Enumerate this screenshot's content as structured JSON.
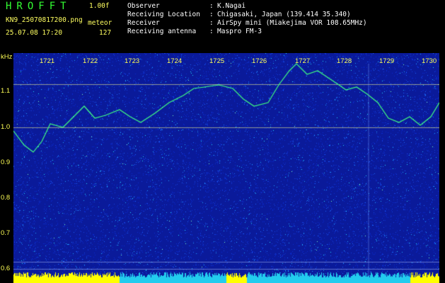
{
  "header": {
    "title": "HROFFT",
    "version": "1.00f",
    "filename": "KN9_25070817200.png",
    "mode": "meteor",
    "datetime": "25.07.08 17:20",
    "count": "127",
    "fields": [
      {
        "label": "Observer",
        "value": "K.Nagai"
      },
      {
        "label": "Receiving Location",
        "value": "Chigasaki, Japan (139.414 35.340)"
      },
      {
        "label": "Receiver",
        "value": "AirSpy mini (Miakejima VOR 108.65MHz)"
      },
      {
        "label": "Receiving antenna",
        "value": "Maspro FM-3"
      }
    ]
  },
  "plot": {
    "y_unit": "kHz",
    "y_ticks": [
      "1.1",
      "1.0",
      "0.9",
      "0.8",
      "0.7",
      "0.6"
    ],
    "x_ticks": [
      "1721",
      "1722",
      "1723",
      "1724",
      "1725",
      "1726",
      "1727",
      "1728",
      "1729",
      "1730"
    ],
    "colors": {
      "background": "#0a1a9a",
      "noise_hi": "#22ddff",
      "signal": "#40ff80",
      "axis_text": "#ffff55",
      "baseline": "#ffff00"
    }
  }
}
